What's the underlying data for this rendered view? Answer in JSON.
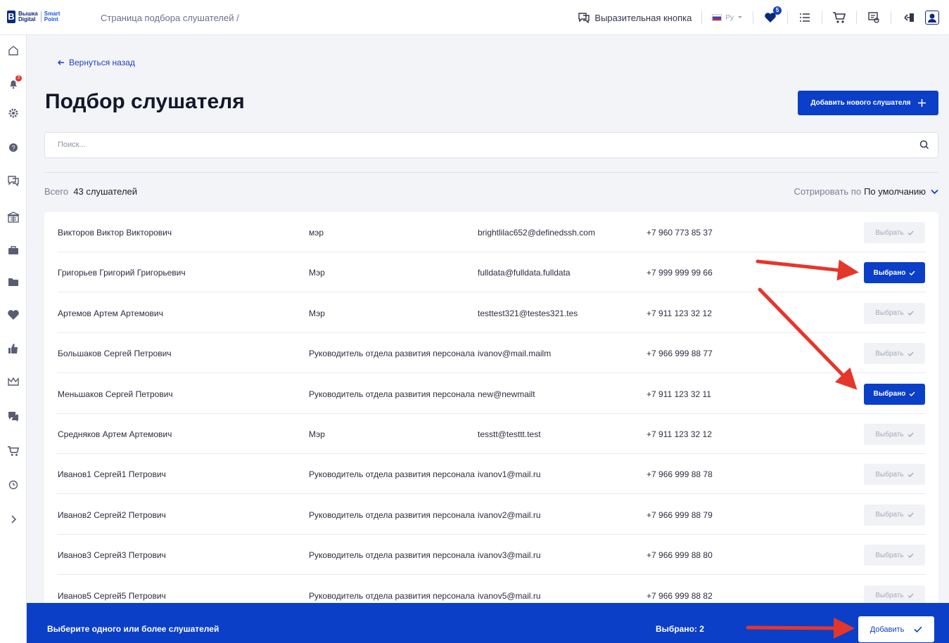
{
  "header": {
    "logo_line1": "Вышка",
    "logo_line2": "Digital",
    "logo_line3": "Smart",
    "logo_line4": "Point",
    "breadcrumb": "Страница подбора слушателей  /",
    "feedback_label": "Выразительная кнопка",
    "lang_label": "Ру",
    "favorites_badge": "5"
  },
  "sidebar": {
    "notifications_badge": "3"
  },
  "page": {
    "back_label": "Вернуться назад",
    "title": "Подбор слушателя",
    "add_new_label": "Добавить нового слушателя",
    "search_placeholder": "Поиск...",
    "total_prefix": "Всего",
    "total_value": "43 слушателей",
    "sort_prefix": "Сотрировать по",
    "sort_value": "По умолчанию"
  },
  "rows": [
    {
      "name": "Викторов Виктор Викторович",
      "position": "мэр",
      "email": "brightlilac652@definedssh.com",
      "phone": "+7 960 773 85 37",
      "button": "Выбрать",
      "selected": false
    },
    {
      "name": "Григорьев Григорий Григорьевич",
      "position": "Мэр",
      "email": "fulldata@fulldata.fulldata",
      "phone": "+7 999 999 99 66",
      "button": "Выбрано",
      "selected": true
    },
    {
      "name": "Артемов Артем Артемович",
      "position": "Мэр",
      "email": "testtest321@testes321.tes",
      "phone": "+7 911 123 32 12",
      "button": "Выбрать",
      "selected": false
    },
    {
      "name": "Большаков Сергей Петрович",
      "position": "Руководитель отдела развития персонала",
      "email": "ivanov@mail.mailm",
      "phone": "+7 966 999 88 77",
      "button": "Выбрать",
      "selected": false
    },
    {
      "name": "Меньшаков Сергей Петрович",
      "position": "Руководитель отдела развития персонала",
      "email": "new@newmailt",
      "phone": "+7 911 123 32 11",
      "button": "Выбрано",
      "selected": true
    },
    {
      "name": "Средняков Артем Артемович",
      "position": "Мэр",
      "email": "tesstt@testtt.test",
      "phone": "+7 911 123 32 12",
      "button": "Выбрать",
      "selected": false
    },
    {
      "name": "Иванов1 Сергей1 Петрович",
      "position": "Руководитель отдела развития персонала",
      "email": "ivanov1@mail.ru",
      "phone": "+7 966 999 88 78",
      "button": "Выбрать",
      "selected": false
    },
    {
      "name": "Иванов2 Сергей2 Петрович",
      "position": "Руководитель отдела развития персонала",
      "email": "ivanov2@mail.ru",
      "phone": "+7 966 999 88 79",
      "button": "Выбрать",
      "selected": false
    },
    {
      "name": "Иванов3 Сергей3 Петрович",
      "position": "Руководитель отдела развития персонала",
      "email": "ivanov3@mail.ru",
      "phone": "+7 966 999 88 80",
      "button": "Выбрать",
      "selected": false
    },
    {
      "name": "Иванов5 Сергей5 Петрович",
      "position": "Руководитель отдела развития персонала",
      "email": "ivanov5@mail.ru",
      "phone": "+7 966 999 88 82",
      "button": "Выбрать",
      "selected": false
    }
  ],
  "footer": {
    "message": "Выберите одного или более слушателей",
    "selected_count": "Выбрано: 2",
    "add_label": "Добавить"
  },
  "colors": {
    "accent": "#0b3fc8",
    "annotation_arrow": "#e5362b"
  }
}
